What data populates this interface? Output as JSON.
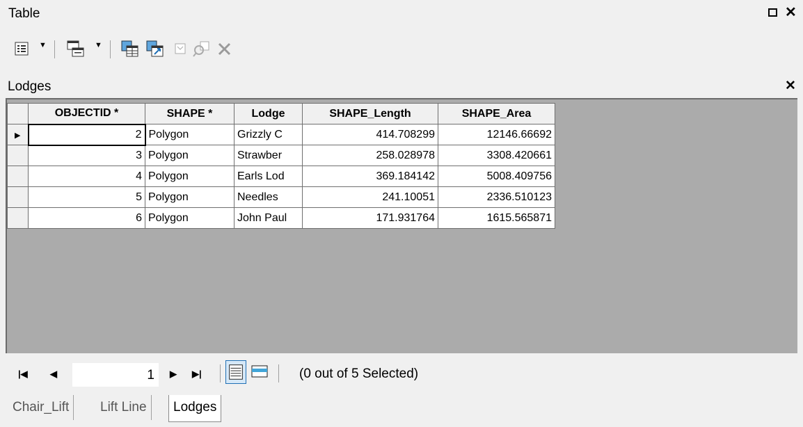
{
  "window": {
    "title": "Table"
  },
  "toolbar": {
    "icons": [
      "table-options-icon",
      "related-tables-icon",
      "select-by-attributes-icon",
      "switch-selection-icon",
      "clear-selection-icon",
      "zoom-to-selected-icon",
      "delete-selected-icon"
    ]
  },
  "table": {
    "name": "Lodges",
    "columns": [
      "OBJECTID *",
      "SHAPE *",
      "Lodge",
      "SHAPE_Length",
      "SHAPE_Area"
    ],
    "rows": [
      {
        "objectid": "2",
        "shape": "Polygon",
        "lodge": "Grizzly C",
        "length": "414.708299",
        "area": "12146.66692"
      },
      {
        "objectid": "3",
        "shape": "Polygon",
        "lodge": "Strawber",
        "length": "258.028978",
        "area": "3308.420661"
      },
      {
        "objectid": "4",
        "shape": "Polygon",
        "lodge": "Earls Lod",
        "length": "369.184142",
        "area": "5008.409756"
      },
      {
        "objectid": "5",
        "shape": "Polygon",
        "lodge": "Needles",
        "length": "241.10051",
        "area": "2336.510123"
      },
      {
        "objectid": "6",
        "shape": "Polygon",
        "lodge": "John Paul",
        "length": "171.931764",
        "area": "1615.565871"
      }
    ]
  },
  "navigator": {
    "current_record": "1",
    "selection_status": "(0 out of 5 Selected)"
  },
  "tabs": [
    {
      "label": "Chair_Lift"
    },
    {
      "label": "Lift Line"
    },
    {
      "label": "Lodges"
    }
  ],
  "colors": {
    "grid_background": "#ababab",
    "chrome": "#f0f0f0",
    "selected_icon": "#1f6fb5"
  }
}
